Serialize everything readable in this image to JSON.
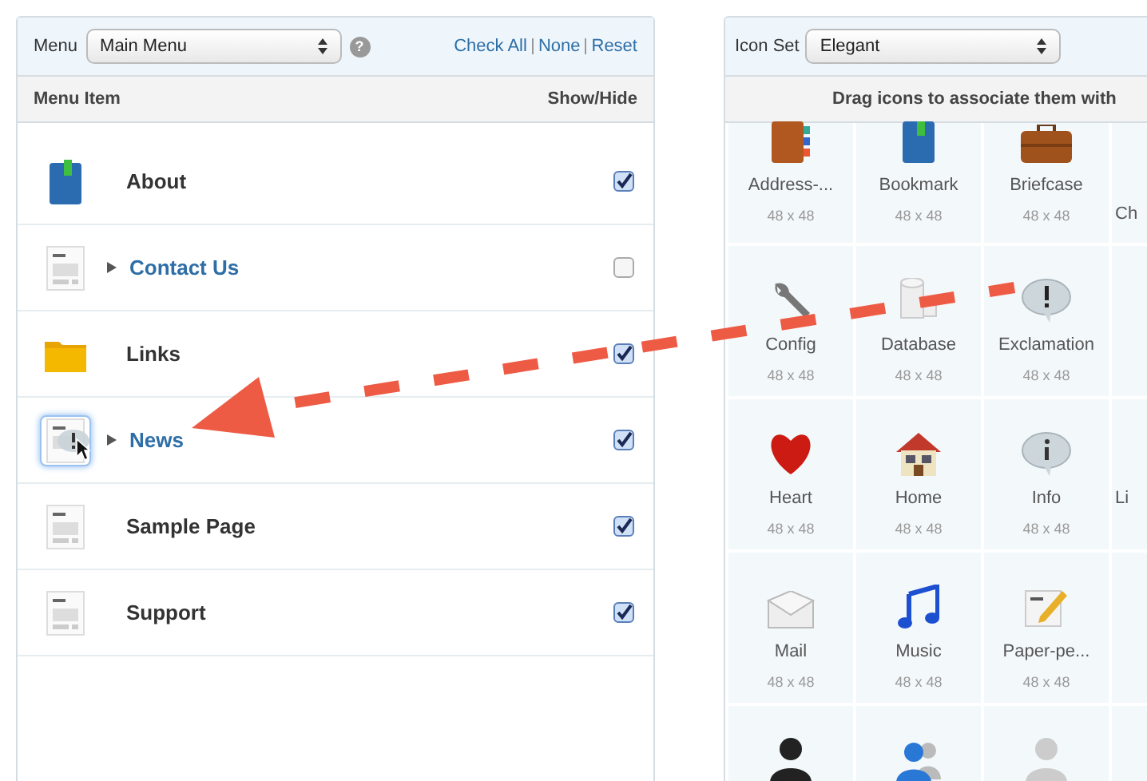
{
  "menu_panel": {
    "menu_label": "Menu",
    "menu_select": "Main Menu",
    "help_icon": "?",
    "links": [
      "Check All",
      "None",
      "Reset"
    ],
    "columns": [
      "Menu Item",
      "Show/Hide"
    ],
    "items": [
      {
        "label": "About",
        "checked": true,
        "has_children": false,
        "drop_target": false
      },
      {
        "label": "Contact Us",
        "checked": false,
        "has_children": true,
        "drop_target": false
      },
      {
        "label": "Links",
        "checked": true,
        "has_children": false,
        "drop_target": false
      },
      {
        "label": "News",
        "checked": true,
        "has_children": true,
        "drop_target": true
      },
      {
        "label": "Sample Page",
        "checked": true,
        "has_children": false,
        "drop_target": false
      },
      {
        "label": "Support",
        "checked": true,
        "has_children": false,
        "drop_target": false
      }
    ]
  },
  "icon_panel": {
    "icon_set_label": "Icon Set",
    "icon_set_select": "Elegant",
    "instruction": "Drag icons to associate them with",
    "rows": [
      [
        {
          "label": "Address-...",
          "size": "48 x 48"
        },
        {
          "label": "Bookmark",
          "size": "48 x 48"
        },
        {
          "label": "Briefcase",
          "size": "48 x 48"
        },
        {
          "label": "Ch"
        }
      ],
      [
        {
          "label": "Config",
          "size": "48 x 48"
        },
        {
          "label": "Database",
          "size": "48 x 48"
        },
        {
          "label": "Exclamation",
          "size": "48 x 48"
        },
        {}
      ],
      [
        {
          "label": "Heart",
          "size": "48 x 48"
        },
        {
          "label": "Home",
          "size": "48 x 48"
        },
        {
          "label": "Info",
          "size": "48 x 48"
        },
        {
          "label": "Li"
        }
      ],
      [
        {
          "label": "Mail",
          "size": "48 x 48"
        },
        {
          "label": "Music",
          "size": "48 x 48"
        },
        {
          "label": "Paper-pe...",
          "size": "48 x 48"
        },
        {}
      ],
      [
        {},
        {},
        {},
        {}
      ]
    ]
  }
}
